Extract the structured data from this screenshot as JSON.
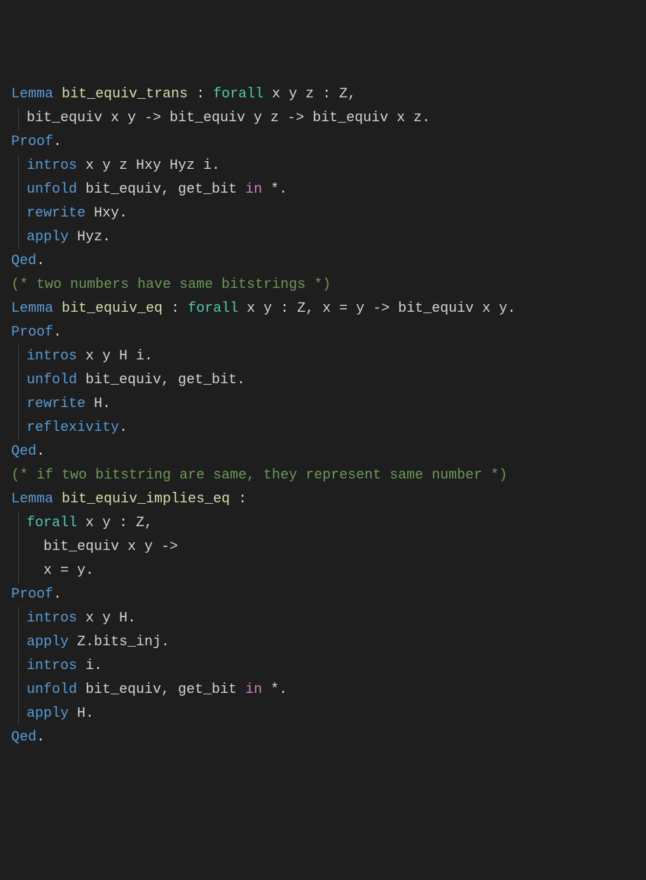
{
  "lines": [
    {
      "indent": 0,
      "tokens": [
        {
          "t": "Lemma",
          "c": "keyword"
        },
        {
          "t": " "
        },
        {
          "t": "bit_equiv_trans",
          "c": "ident"
        },
        {
          "t": " : "
        },
        {
          "t": "forall",
          "c": "constr"
        },
        {
          "t": " x y z : Z,",
          "c": "var"
        }
      ]
    },
    {
      "indent": 1,
      "tokens": [
        {
          "t": "bit_equiv x y -> bit_equiv y z -> bit_equiv x z.",
          "c": "var"
        }
      ]
    },
    {
      "indent": 0,
      "tokens": [
        {
          "t": "Proof",
          "c": "keyword"
        },
        {
          "t": ".",
          "c": "punct"
        }
      ]
    },
    {
      "indent": 1,
      "tokens": [
        {
          "t": "intros",
          "c": "keyword"
        },
        {
          "t": " x y z Hxy Hyz i.",
          "c": "var"
        }
      ]
    },
    {
      "indent": 1,
      "tokens": [
        {
          "t": "unfold",
          "c": "keyword"
        },
        {
          "t": " bit_equiv, get_bit ",
          "c": "var"
        },
        {
          "t": "in",
          "c": "in"
        },
        {
          "t": " *.",
          "c": "var"
        }
      ]
    },
    {
      "indent": 1,
      "tokens": [
        {
          "t": "rewrite",
          "c": "keyword"
        },
        {
          "t": " Hxy.",
          "c": "var"
        }
      ]
    },
    {
      "indent": 1,
      "tokens": [
        {
          "t": "apply",
          "c": "keyword"
        },
        {
          "t": " Hyz.",
          "c": "var"
        }
      ]
    },
    {
      "indent": 0,
      "tokens": [
        {
          "t": "Qed",
          "c": "keyword"
        },
        {
          "t": ".",
          "c": "punct"
        }
      ]
    },
    {
      "indent": 0,
      "tokens": [
        {
          "t": ""
        }
      ]
    },
    {
      "indent": 0,
      "tokens": [
        {
          "t": "(* two numbers have same bitstrings *)",
          "c": "comment"
        }
      ]
    },
    {
      "indent": 0,
      "tokens": [
        {
          "t": "Lemma",
          "c": "keyword"
        },
        {
          "t": " "
        },
        {
          "t": "bit_equiv_eq",
          "c": "ident"
        },
        {
          "t": " : "
        },
        {
          "t": "forall",
          "c": "constr"
        },
        {
          "t": " x y : Z, x = y -> bit_equiv x y.",
          "c": "var"
        }
      ]
    },
    {
      "indent": 0,
      "tokens": [
        {
          "t": "Proof",
          "c": "keyword"
        },
        {
          "t": ".",
          "c": "punct"
        }
      ]
    },
    {
      "indent": 1,
      "tokens": [
        {
          "t": "intros",
          "c": "keyword"
        },
        {
          "t": " x y H i.",
          "c": "var"
        }
      ]
    },
    {
      "indent": 1,
      "tokens": [
        {
          "t": "unfold",
          "c": "keyword"
        },
        {
          "t": " bit_equiv, get_bit.",
          "c": "var"
        }
      ]
    },
    {
      "indent": 1,
      "tokens": [
        {
          "t": "rewrite",
          "c": "keyword"
        },
        {
          "t": " H.",
          "c": "var"
        }
      ]
    },
    {
      "indent": 1,
      "tokens": [
        {
          "t": "reflexivity",
          "c": "keyword"
        },
        {
          "t": ".",
          "c": "var"
        }
      ]
    },
    {
      "indent": 0,
      "tokens": [
        {
          "t": "Qed",
          "c": "keyword"
        },
        {
          "t": ".",
          "c": "punct"
        }
      ]
    },
    {
      "indent": 0,
      "tokens": [
        {
          "t": ""
        }
      ]
    },
    {
      "indent": 0,
      "tokens": [
        {
          "t": "(* if two bitstring are same, they represent same number *)",
          "c": "comment"
        }
      ]
    },
    {
      "indent": 0,
      "tokens": [
        {
          "t": "Lemma",
          "c": "keyword"
        },
        {
          "t": " "
        },
        {
          "t": "bit_equiv_implies_eq",
          "c": "ident"
        },
        {
          "t": " :",
          "c": "var"
        }
      ]
    },
    {
      "indent": 1,
      "tokens": [
        {
          "t": "forall",
          "c": "constr"
        },
        {
          "t": " x y : Z,",
          "c": "var"
        }
      ]
    },
    {
      "indent": 2,
      "tokens": [
        {
          "t": "bit_equiv x y ->",
          "c": "var"
        }
      ]
    },
    {
      "indent": 2,
      "tokens": [
        {
          "t": "x = y.",
          "c": "var"
        }
      ]
    },
    {
      "indent": 0,
      "tokens": [
        {
          "t": "Proof",
          "c": "keyword"
        },
        {
          "t": ".",
          "c": "punct"
        }
      ]
    },
    {
      "indent": 1,
      "tokens": [
        {
          "t": "intros",
          "c": "keyword"
        },
        {
          "t": " x y H.",
          "c": "var"
        }
      ]
    },
    {
      "indent": 1,
      "tokens": [
        {
          "t": "apply",
          "c": "keyword"
        },
        {
          "t": " Z.bits_inj.",
          "c": "var"
        }
      ]
    },
    {
      "indent": 1,
      "tokens": [
        {
          "t": "intros",
          "c": "keyword"
        },
        {
          "t": " i.",
          "c": "var"
        }
      ]
    },
    {
      "indent": 1,
      "tokens": [
        {
          "t": "unfold",
          "c": "keyword"
        },
        {
          "t": " bit_equiv, get_bit ",
          "c": "var"
        },
        {
          "t": "in",
          "c": "in"
        },
        {
          "t": " *.",
          "c": "var"
        }
      ]
    },
    {
      "indent": 1,
      "tokens": [
        {
          "t": "apply",
          "c": "keyword"
        },
        {
          "t": " H.",
          "c": "var"
        }
      ]
    },
    {
      "indent": 0,
      "tokens": [
        {
          "t": "Qed",
          "c": "keyword"
        },
        {
          "t": ".",
          "c": "punct"
        }
      ]
    }
  ]
}
